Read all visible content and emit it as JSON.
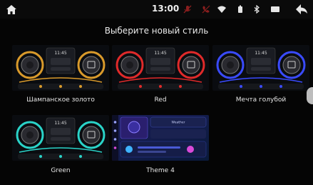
{
  "status_bar": {
    "time": "13:00",
    "icons": [
      "home-icon",
      "mic-muted-icon",
      "phone-muted-icon",
      "wifi-icon",
      "battery-icon",
      "bluetooth-icon",
      "gallery-icon",
      "back-arrow-icon"
    ],
    "mute_color": "#8a1e1e"
  },
  "page": {
    "title": "Выберите новый стиль"
  },
  "themes": [
    {
      "label": "Шампанское золото",
      "accent": "#d99a2b"
    },
    {
      "label": "Red",
      "accent": "#e02a2a"
    },
    {
      "label": "Мечта голубой",
      "accent": "#3a4bff"
    },
    {
      "label": "Green",
      "accent": "#2ad3c8"
    },
    {
      "label": "Theme 4",
      "accent": "#5a3fd6"
    }
  ],
  "thumbnail_clock": {
    "time": "11:45"
  },
  "theme4": {
    "panel_title": "Weather"
  }
}
